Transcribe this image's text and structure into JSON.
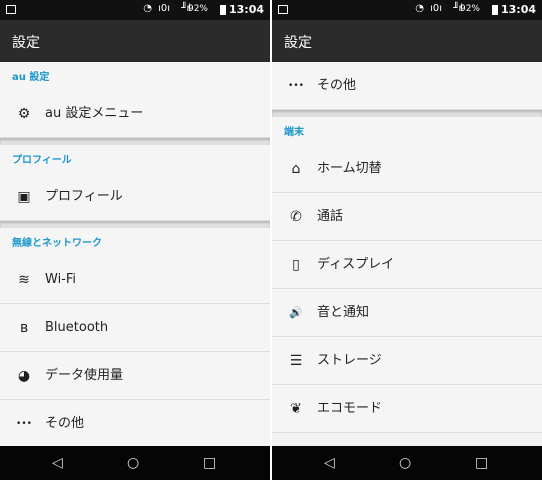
{
  "statusbar": {
    "battery": "92%",
    "time": "13:04",
    "signal": "╜ıl",
    "vibrate": "ı0ı",
    "nfc": "◔"
  },
  "left": {
    "title": "設定",
    "sections": [
      {
        "header": "au 設定",
        "items": [
          {
            "label": "au 設定メニュー",
            "icon": "gear-icon",
            "glyph": "⚙"
          }
        ]
      },
      {
        "header": "プロフィール",
        "items": [
          {
            "label": "プロフィール",
            "icon": "profile-icon",
            "glyph": "▣"
          }
        ]
      },
      {
        "header": "無線とネットワーク",
        "items": [
          {
            "label": "Wi-Fi",
            "icon": "wifi-icon",
            "glyph": "≋"
          },
          {
            "label": "Bluetooth",
            "icon": "bluetooth-icon",
            "glyph": "ʙ"
          },
          {
            "label": "データ使用量",
            "icon": "data-usage-icon",
            "glyph": "◕"
          },
          {
            "label": "その他",
            "icon": "more-icon",
            "glyph": "•••"
          }
        ]
      }
    ]
  },
  "right": {
    "title": "設定",
    "top_items": [
      {
        "label": "その他",
        "icon": "more-icon",
        "glyph": "•••"
      }
    ],
    "sections": [
      {
        "header": "端末",
        "items": [
          {
            "label": "ホーム切替",
            "icon": "home-icon",
            "glyph": "⌂"
          },
          {
            "label": "通話",
            "icon": "phone-icon",
            "glyph": "✆"
          },
          {
            "label": "ディスプレイ",
            "icon": "display-icon",
            "glyph": "▯"
          },
          {
            "label": "音と通知",
            "icon": "volume-icon",
            "glyph": "🔊"
          },
          {
            "label": "ストレージ",
            "icon": "storage-icon",
            "glyph": "☰"
          },
          {
            "label": "エコモード",
            "icon": "leaf-icon",
            "glyph": "❦"
          }
        ]
      }
    ]
  },
  "navbar": {
    "back": "◁",
    "home": "○",
    "recents": "□"
  }
}
